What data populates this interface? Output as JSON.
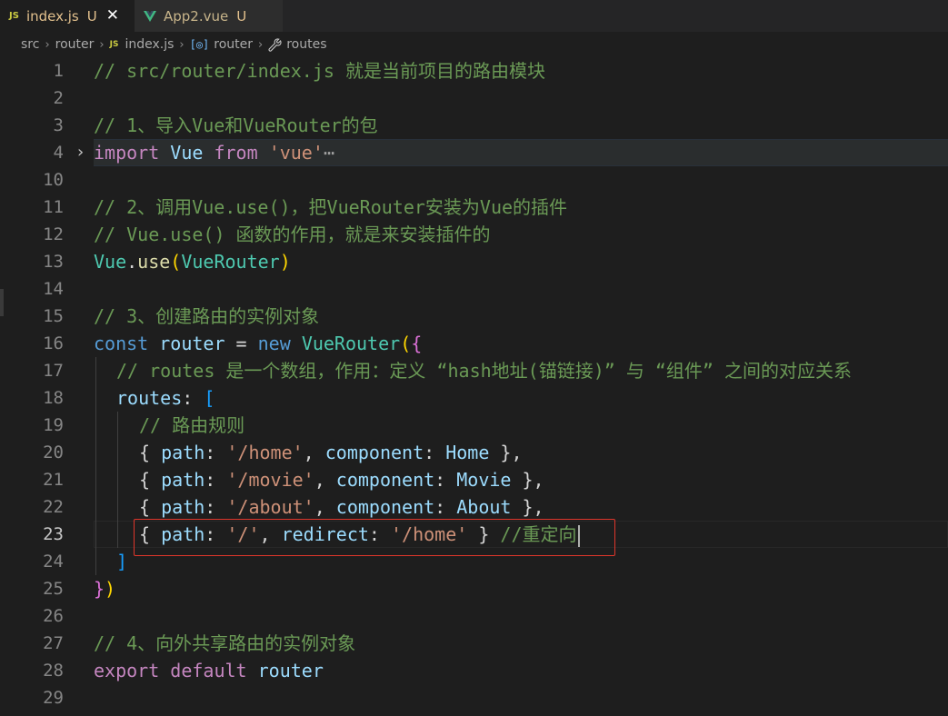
{
  "tabs": [
    {
      "badge": "JS",
      "label": "index.js",
      "status": "U",
      "close": "✕"
    },
    {
      "label": "App2.vue",
      "status": "U"
    }
  ],
  "breadcrumb": {
    "items": [
      "src",
      "router",
      "index.js",
      "router",
      "routes"
    ],
    "separator": "›",
    "js_badge": "JS",
    "var_icon": "[◎]"
  },
  "editor": {
    "fold_chevron": "›",
    "ellipsis": "⋯",
    "line_numbers": [
      "1",
      "2",
      "3",
      "4",
      "10",
      "11",
      "12",
      "13",
      "14",
      "15",
      "16",
      "17",
      "18",
      "19",
      "20",
      "21",
      "22",
      "23",
      "24",
      "25",
      "26",
      "27",
      "28",
      "29"
    ],
    "current_line": "23",
    "code": {
      "l1": {
        "comment": "// src/router/index.js 就是当前项目的路由模块"
      },
      "l3": {
        "comment": "// 1、导入Vue和VueRouter的包"
      },
      "l4": {
        "import": "import",
        "vue": "Vue",
        "from": "from",
        "str": "'vue'"
      },
      "l11": {
        "comment": "// 2、调用Vue.use()，把VueRouter安装为Vue的插件"
      },
      "l12": {
        "comment": "// Vue.use() 函数的作用，就是来安装插件的"
      },
      "l13": {
        "obj": "Vue",
        "dot": ".",
        "fn": "use",
        "open": "(",
        "arg": "VueRouter",
        "close": ")"
      },
      "l15": {
        "comment": "// 3、创建路由的实例对象"
      },
      "l16": {
        "const": "const",
        "name": "router",
        "eq": " = ",
        "new": "new",
        "cls": "VueRouter",
        "paren": "(",
        "brace": "{"
      },
      "l17": {
        "comment": "// routes 是一个数组，作用：定义 “hash地址(锚链接)” 与 “组件” 之间的对应关系"
      },
      "l18": {
        "key": "routes",
        "colon": ": ",
        "bracket": "["
      },
      "l19": {
        "comment": "// 路由规则"
      },
      "l20": {
        "open": "{ ",
        "k1": "path",
        "c1": ": ",
        "v1": "'/home'",
        "sep": ", ",
        "k2": "component",
        "c2": ": ",
        "v2": "Home",
        "close": " },"
      },
      "l21": {
        "open": "{ ",
        "k1": "path",
        "c1": ": ",
        "v1": "'/movie'",
        "sep": ", ",
        "k2": "component",
        "c2": ": ",
        "v2": "Movie",
        "close": " },"
      },
      "l22": {
        "open": "{ ",
        "k1": "path",
        "c1": ": ",
        "v1": "'/about'",
        "sep": ", ",
        "k2": "component",
        "c2": ": ",
        "v2": "About",
        "close": " },"
      },
      "l23": {
        "open": "{ ",
        "k1": "path",
        "c1": ": ",
        "v1": "'/'",
        "sep": ", ",
        "k2": "redirect",
        "c2": ": ",
        "v2": "'/home'",
        "close": " } ",
        "comment": "//重定向"
      },
      "l24": {
        "bracket": "]"
      },
      "l25": {
        "brace": "}",
        "paren": ")"
      },
      "l27": {
        "comment": "// 4、向外共享路由的实例对象"
      },
      "l28": {
        "export": "export",
        "default": "default",
        "name": "router"
      }
    }
  }
}
